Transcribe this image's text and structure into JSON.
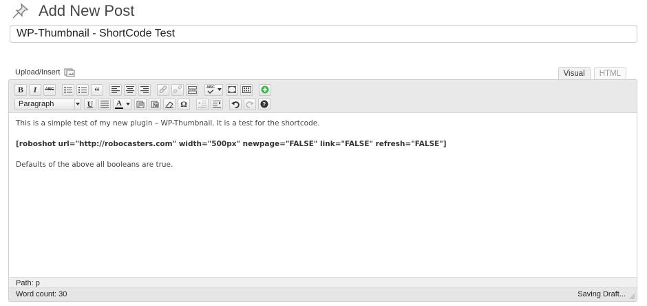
{
  "page": {
    "title": "Add New Post",
    "post_title": "WP-Thumbnail - ShortCode Test",
    "upload_label": "Upload/Insert"
  },
  "tabs": [
    {
      "label": "Visual",
      "active": true
    },
    {
      "label": "HTML",
      "active": false
    }
  ],
  "toolbar": {
    "row1": [
      "bold",
      "italic",
      "strikethrough",
      "bullet-list",
      "numbered-list",
      "blockquote",
      "align-left",
      "align-center",
      "align-right",
      "insert-link",
      "unlink",
      "insert-more",
      "spellcheck",
      "fullscreen",
      "kitchen-sink",
      "add-media"
    ],
    "bold_label": "B",
    "italic_label": "I",
    "strike_label": "ABC",
    "quote_label": "“",
    "spell_label": "ABC",
    "format_value": "Paragraph",
    "underline_label": "U",
    "textcolor_label": "A",
    "omega_label": "Ω"
  },
  "content": {
    "para1": "This is a simple test of my new plugin – WP-Thumbnail. It is a test for the shortcode.",
    "para2": "[roboshot url=\"http://robocasters.com\" width=\"500px\" newpage=\"FALSE\" link=\"FALSE\" refresh=\"FALSE\"]",
    "para3": "Defaults of the above all booleans are true."
  },
  "footer": {
    "path": "Path: p",
    "word_count": "Word count: 30",
    "status": "Saving Draft..."
  },
  "colors": {
    "toolbar_bg": "#e9e9e9",
    "border": "#cfcfcf",
    "add_media_green": "#4caf50"
  }
}
